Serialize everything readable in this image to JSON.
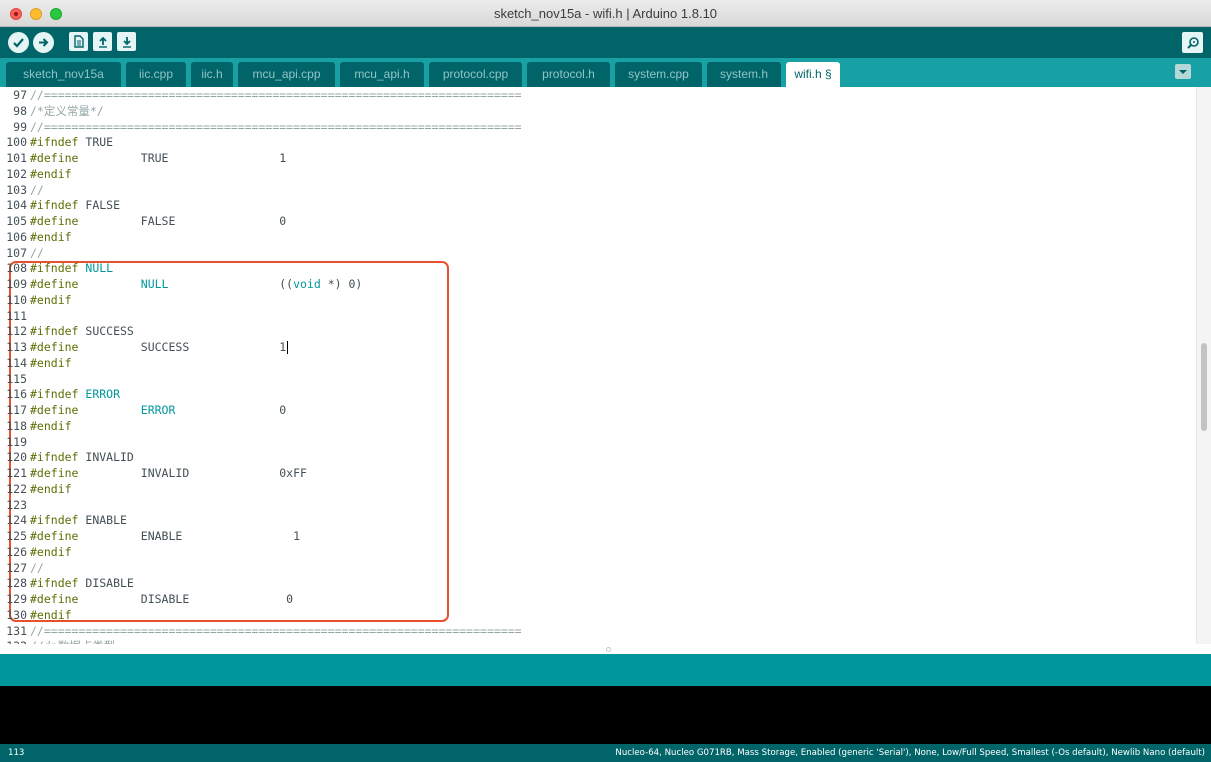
{
  "window": {
    "title": "sketch_nov15a - wifi.h | Arduino 1.8.10"
  },
  "toolbar": {
    "buttons": [
      {
        "name": "verify-button",
        "icon": "checkmark-icon"
      },
      {
        "name": "upload-button",
        "icon": "arrow-right-icon"
      },
      {
        "name": "new-button",
        "icon": "document-icon"
      },
      {
        "name": "open-button",
        "icon": "arrow-up-icon"
      },
      {
        "name": "save-button",
        "icon": "arrow-down-icon"
      }
    ],
    "serial_monitor_icon": "magnifier-icon"
  },
  "tabs": [
    {
      "label": "sketch_nov15a",
      "active": false
    },
    {
      "label": "iic.cpp",
      "active": false
    },
    {
      "label": "iic.h",
      "active": false
    },
    {
      "label": "mcu_api.cpp",
      "active": false
    },
    {
      "label": "mcu_api.h",
      "active": false
    },
    {
      "label": "protocol.cpp",
      "active": false
    },
    {
      "label": "protocol.h",
      "active": false
    },
    {
      "label": "system.cpp",
      "active": false
    },
    {
      "label": "system.h",
      "active": false
    },
    {
      "label": "wifi.h §",
      "active": true
    }
  ],
  "editor": {
    "lines": [
      {
        "n": "97",
        "parts": [
          {
            "t": "//=====================================================================",
            "c": "comment"
          }
        ]
      },
      {
        "n": "98",
        "parts": [
          {
            "t": "/*定义常量*/",
            "c": "comment"
          }
        ]
      },
      {
        "n": "99",
        "parts": [
          {
            "t": "//=====================================================================",
            "c": "comment"
          }
        ]
      },
      {
        "n": "100",
        "parts": [
          {
            "t": "#ifndef",
            "c": "kw-pre"
          },
          {
            "t": " TRUE",
            "c": ""
          }
        ]
      },
      {
        "n": "101",
        "parts": [
          {
            "t": "#define",
            "c": "kw-pre"
          },
          {
            "t": "         TRUE                1",
            "c": ""
          }
        ]
      },
      {
        "n": "102",
        "parts": [
          {
            "t": "#endif",
            "c": "kw-pre"
          }
        ]
      },
      {
        "n": "103",
        "parts": [
          {
            "t": "//",
            "c": "comment"
          }
        ]
      },
      {
        "n": "104",
        "parts": [
          {
            "t": "#ifndef",
            "c": "kw-pre"
          },
          {
            "t": " FALSE",
            "c": ""
          }
        ]
      },
      {
        "n": "105",
        "parts": [
          {
            "t": "#define",
            "c": "kw-pre"
          },
          {
            "t": "         FALSE               0",
            "c": ""
          }
        ]
      },
      {
        "n": "106",
        "parts": [
          {
            "t": "#endif",
            "c": "kw-pre"
          }
        ]
      },
      {
        "n": "107",
        "parts": [
          {
            "t": "//",
            "c": "comment"
          }
        ]
      },
      {
        "n": "108",
        "parts": [
          {
            "t": "#ifndef",
            "c": "kw-pre"
          },
          {
            "t": " ",
            "c": ""
          },
          {
            "t": "NULL",
            "c": "kw-const"
          }
        ]
      },
      {
        "n": "109",
        "parts": [
          {
            "t": "#define",
            "c": "kw-pre"
          },
          {
            "t": "         ",
            "c": ""
          },
          {
            "t": "NULL",
            "c": "kw-const"
          },
          {
            "t": "                ((",
            "c": ""
          },
          {
            "t": "void",
            "c": "kw-type"
          },
          {
            "t": " *) 0)",
            "c": ""
          }
        ]
      },
      {
        "n": "110",
        "parts": [
          {
            "t": "#endif",
            "c": "kw-pre"
          }
        ]
      },
      {
        "n": "111",
        "parts": []
      },
      {
        "n": "112",
        "parts": [
          {
            "t": "#ifndef",
            "c": "kw-pre"
          },
          {
            "t": " SUCCESS",
            "c": ""
          }
        ]
      },
      {
        "n": "113",
        "parts": [
          {
            "t": "#define",
            "c": "kw-pre"
          },
          {
            "t": "         SUCCESS             1",
            "c": ""
          }
        ],
        "cursor": true
      },
      {
        "n": "114",
        "parts": [
          {
            "t": "#endif",
            "c": "kw-pre"
          }
        ]
      },
      {
        "n": "115",
        "parts": []
      },
      {
        "n": "116",
        "parts": [
          {
            "t": "#ifndef",
            "c": "kw-pre"
          },
          {
            "t": " ",
            "c": ""
          },
          {
            "t": "ERROR",
            "c": "kw-const"
          }
        ]
      },
      {
        "n": "117",
        "parts": [
          {
            "t": "#define",
            "c": "kw-pre"
          },
          {
            "t": "         ",
            "c": ""
          },
          {
            "t": "ERROR",
            "c": "kw-const"
          },
          {
            "t": "               0",
            "c": ""
          }
        ]
      },
      {
        "n": "118",
        "parts": [
          {
            "t": "#endif",
            "c": "kw-pre"
          }
        ]
      },
      {
        "n": "119",
        "parts": []
      },
      {
        "n": "120",
        "parts": [
          {
            "t": "#ifndef",
            "c": "kw-pre"
          },
          {
            "t": " INVALID",
            "c": ""
          }
        ]
      },
      {
        "n": "121",
        "parts": [
          {
            "t": "#define",
            "c": "kw-pre"
          },
          {
            "t": "         INVALID             0xFF",
            "c": ""
          }
        ]
      },
      {
        "n": "122",
        "parts": [
          {
            "t": "#endif",
            "c": "kw-pre"
          }
        ]
      },
      {
        "n": "123",
        "parts": []
      },
      {
        "n": "124",
        "parts": [
          {
            "t": "#ifndef",
            "c": "kw-pre"
          },
          {
            "t": " ENABLE",
            "c": ""
          }
        ]
      },
      {
        "n": "125",
        "parts": [
          {
            "t": "#define",
            "c": "kw-pre"
          },
          {
            "t": "         ENABLE                1",
            "c": ""
          }
        ]
      },
      {
        "n": "126",
        "parts": [
          {
            "t": "#endif",
            "c": "kw-pre"
          }
        ]
      },
      {
        "n": "127",
        "parts": [
          {
            "t": "//",
            "c": "comment"
          }
        ]
      },
      {
        "n": "128",
        "parts": [
          {
            "t": "#ifndef",
            "c": "kw-pre"
          },
          {
            "t": " DISABLE",
            "c": ""
          }
        ]
      },
      {
        "n": "129",
        "parts": [
          {
            "t": "#define",
            "c": "kw-pre"
          },
          {
            "t": "         DISABLE              0",
            "c": ""
          }
        ]
      },
      {
        "n": "130",
        "parts": [
          {
            "t": "#endif",
            "c": "kw-pre"
          }
        ]
      },
      {
        "n": "131",
        "parts": [
          {
            "t": "//=====================================================================",
            "c": "comment"
          }
        ]
      },
      {
        "n": "132",
        "parts": [
          {
            "t": "//dp数据点类型",
            "c": "comment"
          }
        ]
      }
    ]
  },
  "footer": {
    "line_number": "113",
    "board_info": "Nucleo-64, Nucleo G071RB, Mass Storage, Enabled (generic 'Serial'), None, Low/Full Speed, Smallest (-Os default), Newlib Nano (default)"
  },
  "colors": {
    "toolbar": "#006468",
    "tabbar": "#17a1a5",
    "status": "#00979c",
    "highlight": "#e8502f"
  }
}
